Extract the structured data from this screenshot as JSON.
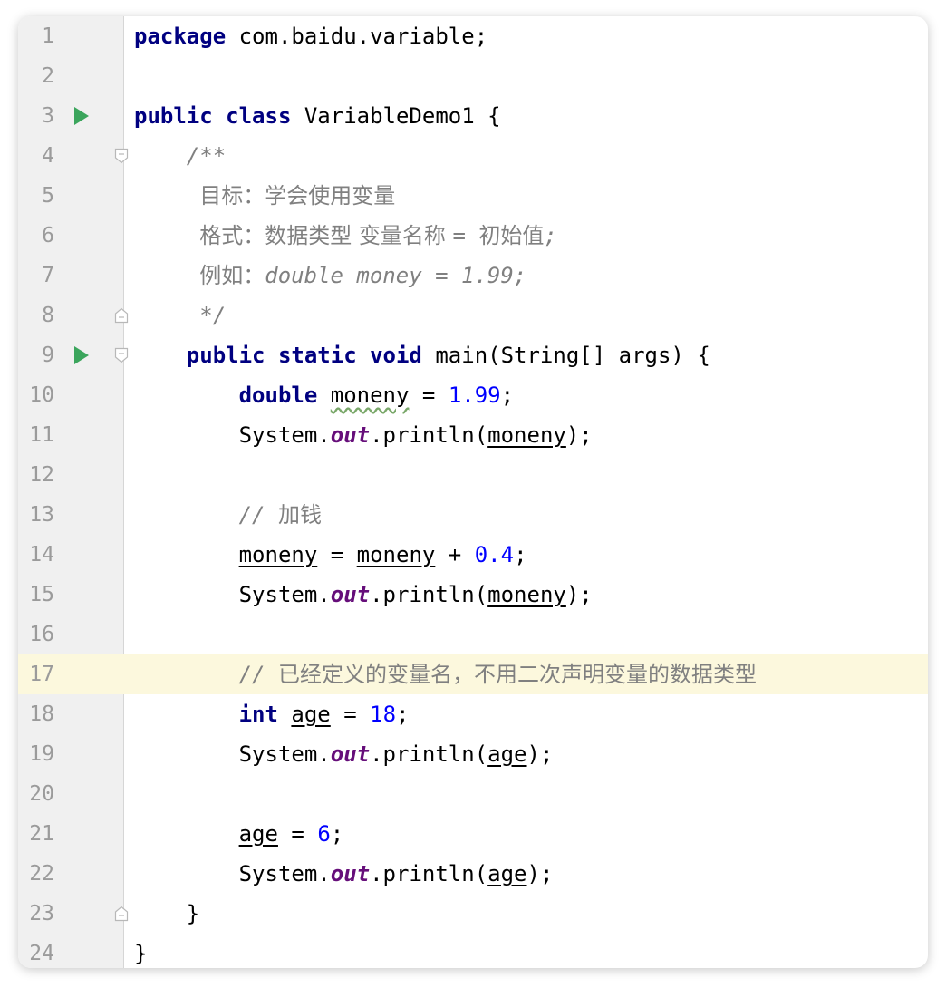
{
  "editor": {
    "language": "java",
    "current_line": 17,
    "colors": {
      "keyword": "#000080",
      "number": "#0000ff",
      "static_field": "#660e7a",
      "comment": "#808080",
      "run_icon": "#3ba55c",
      "current_line_bg": "#fcf8dd"
    },
    "lines": [
      {
        "n": "1",
        "tokens": [
          {
            "t": "package",
            "c": "kw"
          },
          {
            "t": " com.baidu.variable;"
          }
        ]
      },
      {
        "n": "2",
        "tokens": []
      },
      {
        "n": "3",
        "run": true,
        "tokens": [
          {
            "t": "public class",
            "c": "kw"
          },
          {
            "t": " VariableDemo1 {"
          }
        ]
      },
      {
        "n": "4",
        "fold": "open",
        "tokens": [
          {
            "t": "    /**",
            "c": "doc"
          }
        ]
      },
      {
        "n": "5",
        "tokens": [
          {
            "t": "     ",
            "c": "doc"
          },
          {
            "t": "目标：学会使用变量",
            "c": "doc cjk"
          }
        ]
      },
      {
        "n": "6",
        "tokens": [
          {
            "t": "     ",
            "c": "doc"
          },
          {
            "t": "格式：数据类型 变量名称 ",
            "c": "doc cjk"
          },
          {
            "t": "= ",
            "c": "doc"
          },
          {
            "t": "初始值",
            "c": "doc cjk"
          },
          {
            "t": ";",
            "c": "doc"
          }
        ]
      },
      {
        "n": "7",
        "tokens": [
          {
            "t": "     ",
            "c": "doc"
          },
          {
            "t": "例如：",
            "c": "doc cjk"
          },
          {
            "t": "double money = 1.99;",
            "c": "doc"
          }
        ]
      },
      {
        "n": "8",
        "fold": "close",
        "tokens": [
          {
            "t": "     */",
            "c": "doc"
          }
        ]
      },
      {
        "n": "9",
        "run": true,
        "fold": "open",
        "tokens": [
          {
            "t": "    "
          },
          {
            "t": "public static void",
            "c": "kw"
          },
          {
            "t": " main(String[] args) {"
          }
        ]
      },
      {
        "n": "10",
        "tokens": [
          {
            "t": "        "
          },
          {
            "t": "double",
            "c": "kw"
          },
          {
            "t": " "
          },
          {
            "t": "moneny",
            "c": "wavy"
          },
          {
            "t": " = "
          },
          {
            "t": "1.99",
            "c": "num"
          },
          {
            "t": ";"
          }
        ]
      },
      {
        "n": "11",
        "tokens": [
          {
            "t": "        System."
          },
          {
            "t": "out",
            "c": "fld"
          },
          {
            "t": ".println("
          },
          {
            "t": "moneny",
            "c": "var"
          },
          {
            "t": ");"
          }
        ]
      },
      {
        "n": "12",
        "tokens": []
      },
      {
        "n": "13",
        "tokens": [
          {
            "t": "        "
          },
          {
            "t": "// ",
            "c": "cmt"
          },
          {
            "t": "加钱",
            "c": "cmt cjk"
          }
        ]
      },
      {
        "n": "14",
        "tokens": [
          {
            "t": "        "
          },
          {
            "t": "moneny",
            "c": "var"
          },
          {
            "t": " = "
          },
          {
            "t": "moneny",
            "c": "var"
          },
          {
            "t": " + "
          },
          {
            "t": "0.4",
            "c": "num"
          },
          {
            "t": ";"
          }
        ]
      },
      {
        "n": "15",
        "tokens": [
          {
            "t": "        System."
          },
          {
            "t": "out",
            "c": "fld"
          },
          {
            "t": ".println("
          },
          {
            "t": "moneny",
            "c": "var"
          },
          {
            "t": ");"
          }
        ]
      },
      {
        "n": "16",
        "tokens": []
      },
      {
        "n": "17",
        "tokens": [
          {
            "t": "        "
          },
          {
            "t": "// ",
            "c": "cmt"
          },
          {
            "t": "已经定义的变量名，不用二次声明变量的数据类型",
            "c": "cmt cjk"
          }
        ]
      },
      {
        "n": "18",
        "tokens": [
          {
            "t": "        "
          },
          {
            "t": "int",
            "c": "kw"
          },
          {
            "t": " "
          },
          {
            "t": "age",
            "c": "var"
          },
          {
            "t": " = "
          },
          {
            "t": "18",
            "c": "num"
          },
          {
            "t": ";"
          }
        ]
      },
      {
        "n": "19",
        "tokens": [
          {
            "t": "        System."
          },
          {
            "t": "out",
            "c": "fld"
          },
          {
            "t": ".println("
          },
          {
            "t": "age",
            "c": "var"
          },
          {
            "t": ");"
          }
        ]
      },
      {
        "n": "20",
        "tokens": []
      },
      {
        "n": "21",
        "tokens": [
          {
            "t": "        "
          },
          {
            "t": "age",
            "c": "var"
          },
          {
            "t": " = "
          },
          {
            "t": "6",
            "c": "num"
          },
          {
            "t": ";"
          }
        ]
      },
      {
        "n": "22",
        "tokens": [
          {
            "t": "        System."
          },
          {
            "t": "out",
            "c": "fld"
          },
          {
            "t": ".println("
          },
          {
            "t": "age",
            "c": "var"
          },
          {
            "t": ");"
          }
        ]
      },
      {
        "n": "23",
        "fold": "close",
        "tokens": [
          {
            "t": "    }"
          }
        ]
      },
      {
        "n": "24",
        "tokens": [
          {
            "t": "}"
          }
        ]
      }
    ]
  }
}
